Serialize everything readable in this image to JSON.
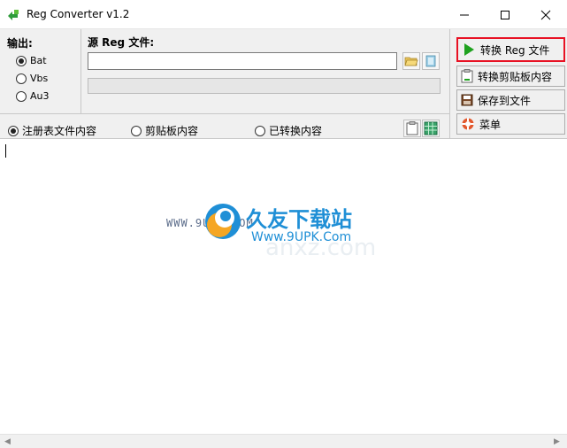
{
  "window": {
    "title": "Reg Converter v1.2",
    "minimize_icon": "minimize-icon",
    "maximize_icon": "maximize-icon",
    "close_icon": "close-icon"
  },
  "output": {
    "label": "输出:",
    "options": [
      {
        "label": "Bat",
        "selected": true
      },
      {
        "label": "Vbs",
        "selected": false
      },
      {
        "label": "Au3",
        "selected": false
      }
    ]
  },
  "source": {
    "label": "源 Reg 文件:",
    "value": "",
    "browse_icon": "folder-open-icon",
    "clear_icon": "eraser-icon",
    "progress": 0
  },
  "view": {
    "options": [
      {
        "label": "注册表文件内容",
        "selected": true
      },
      {
        "label": "剪贴板内容",
        "selected": false
      },
      {
        "label": "已转换内容",
        "selected": false
      }
    ],
    "paste_icon": "clipboard-icon",
    "grid_icon": "grid-icon"
  },
  "actions": {
    "convert_reg": "转换 Reg 文件",
    "convert_clipboard": "转换剪贴板内容",
    "save_file": "保存到文件",
    "menu": "菜单"
  },
  "watermark": {
    "site_name": "久友下载站",
    "url_left": "WWW.9UPK.COM",
    "url_right": "Www.9UPK.Com",
    "faint_text": "anxz.com"
  },
  "colors": {
    "highlight_border": "#e81123",
    "play_green": "#1fa21f",
    "watermark_blue": "#1f8fd6",
    "watermark_orange": "#f5a623"
  }
}
